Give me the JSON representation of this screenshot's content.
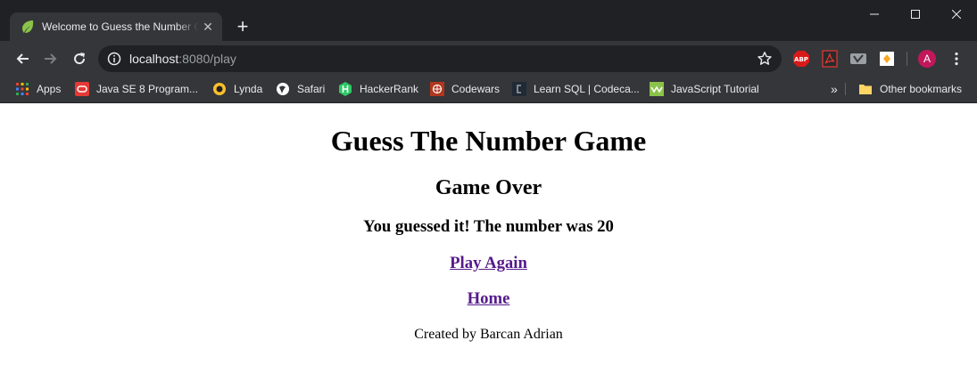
{
  "browser": {
    "tab": {
      "title": "Welcome to Guess the Number Game",
      "close_glyph": "✕",
      "favicon": "spring-leaf-icon"
    },
    "new_tab_glyph": "+",
    "window_controls": [
      "minimize-icon",
      "maximize-icon",
      "close-icon"
    ],
    "address": {
      "host": "localhost",
      "path": ":8080/play"
    },
    "extensions": [
      {
        "name": "adblock-plus-icon",
        "label": "ABP"
      },
      {
        "name": "pdf-icon"
      },
      {
        "name": "vimeo-icon"
      },
      {
        "name": "extension-icon"
      }
    ],
    "profile_initial": "A",
    "colors": {
      "frame": "#202124",
      "toolbar": "#35363a",
      "text": "#e8eaed",
      "profile": "#c2185b"
    }
  },
  "bookmarks": {
    "items": [
      {
        "label": "Apps",
        "icon": "apps-grid-icon"
      },
      {
        "label": "Java SE 8 Program...",
        "icon": "oracle-icon"
      },
      {
        "label": "Lynda",
        "icon": "lynda-icon"
      },
      {
        "label": "Safari",
        "icon": "safari-icon"
      },
      {
        "label": "HackerRank",
        "icon": "hackerrank-icon"
      },
      {
        "label": "Codewars",
        "icon": "codewars-icon"
      },
      {
        "label": "Learn SQL | Codeca...",
        "icon": "codecademy-icon"
      },
      {
        "label": "JavaScript Tutorial",
        "icon": "w3schools-icon"
      }
    ],
    "overflow": "»",
    "other": {
      "label": "Other bookmarks",
      "icon": "folder-icon"
    }
  },
  "page": {
    "title": "Guess The Number Game",
    "subtitle": "Game Over",
    "result": "You guessed it! The number was 20",
    "links": [
      {
        "label": "Play Again"
      },
      {
        "label": "Home"
      }
    ],
    "footer": "Created by Barcan Adrian",
    "colors": {
      "link_visited": "#551a8b"
    }
  }
}
